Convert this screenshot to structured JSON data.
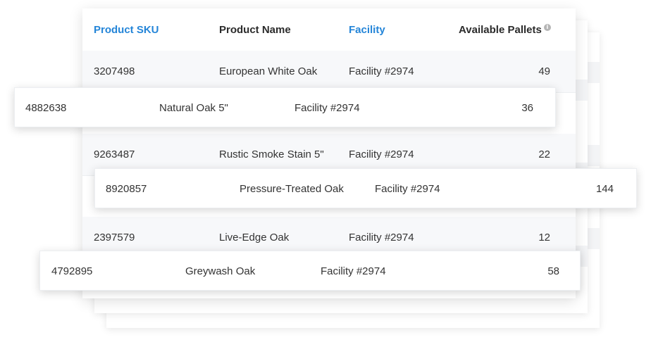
{
  "table": {
    "columns": {
      "sku": "Product SKU",
      "name": "Product Name",
      "facility": "Facility",
      "pallets": "Available Pallets"
    },
    "info_icon": "info-icon",
    "sort_color": "#2485d8",
    "rows": [
      {
        "sku": "3207498",
        "name": "European White Oak",
        "facility": "Facility #2974",
        "pallets": "49"
      },
      {
        "sku": "9263487",
        "name": "Rustic Smoke Stain 5\"",
        "facility": "Facility #2974",
        "pallets": "22"
      },
      {
        "sku": "2397579",
        "name": "Live-Edge Oak",
        "facility": "Facility #2974",
        "pallets": "12"
      }
    ]
  },
  "floating_rows": [
    {
      "sku": "4882638",
      "name": "Natural Oak 5\"",
      "facility": "Facility #2974",
      "pallets": "36"
    },
    {
      "sku": "8920857",
      "name": "Pressure-Treated Oak",
      "facility": "Facility #2974",
      "pallets": "144"
    },
    {
      "sku": "4792895",
      "name": "Greywash Oak",
      "facility": "Facility #2974",
      "pallets": "58"
    }
  ]
}
